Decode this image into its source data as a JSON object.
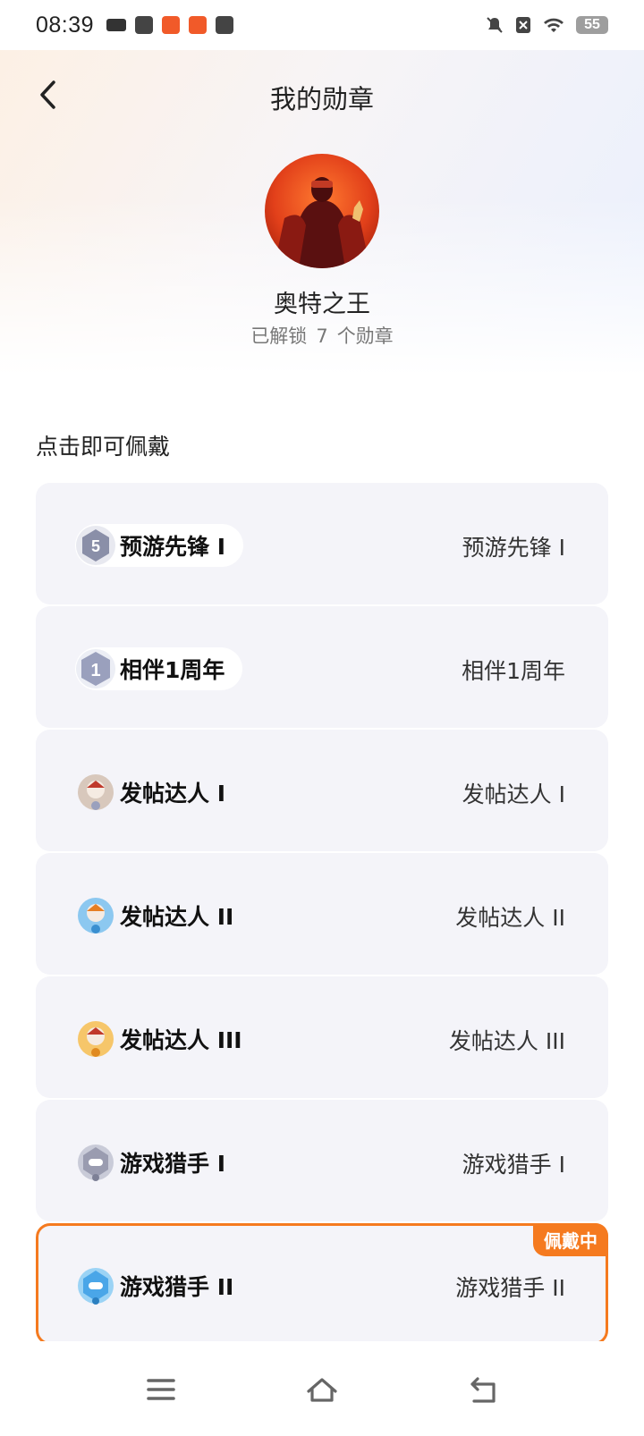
{
  "status_bar": {
    "time": "08:39",
    "battery": "55"
  },
  "nav": {
    "title": "我的勋章"
  },
  "profile": {
    "username": "奥特之王",
    "unlocked_prefix": "已解锁",
    "unlocked_count": "7",
    "unlocked_suffix": "个勋章"
  },
  "section_title": "点击即可佩戴",
  "badges": [
    {
      "pill_label": "预游先锋 I",
      "right_label": "预游先锋 I",
      "icon": "vanguard-badge-icon",
      "color": "#8a8fa8"
    },
    {
      "pill_label": "相伴1周年",
      "right_label": "相伴1周年",
      "icon": "anniversary-badge-icon",
      "color": "#9aa0bd"
    },
    {
      "pill_label": "发帖达人 I",
      "right_label": "发帖达人 I",
      "icon": "poster-badge-icon",
      "color": "#c9a48a"
    },
    {
      "pill_label": "发帖达人 II",
      "right_label": "发帖达人 II",
      "icon": "poster-badge-icon",
      "color": "#5aa8e0"
    },
    {
      "pill_label": "发帖达人 III",
      "right_label": "发帖达人 III",
      "icon": "poster-badge-icon",
      "color": "#f0a23a"
    },
    {
      "pill_label": "游戏猎手 I",
      "right_label": "游戏猎手 I",
      "icon": "hunter-badge-icon",
      "color": "#9a9cb0"
    },
    {
      "pill_label": "游戏猎手 II",
      "right_label": "游戏猎手 II",
      "icon": "hunter-badge-icon",
      "color": "#4aa6e8",
      "tag": "佩戴中"
    }
  ],
  "colors": {
    "accent": "#f57a1f",
    "card_bg": "#f4f4f9"
  }
}
